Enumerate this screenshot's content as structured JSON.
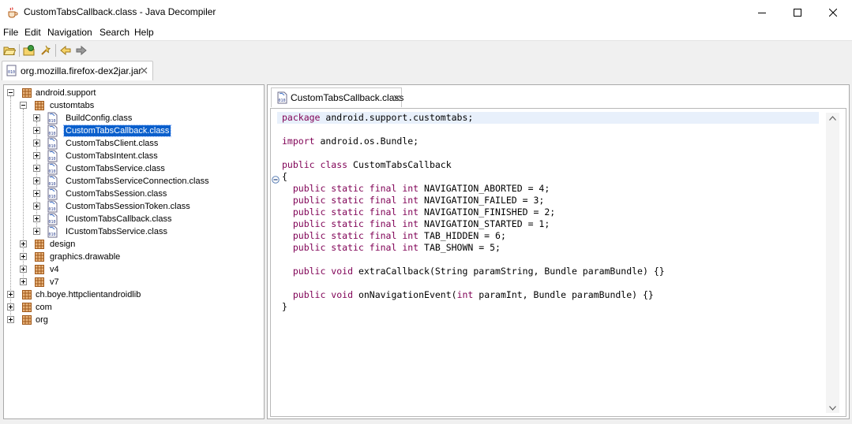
{
  "window": {
    "title": "CustomTabsCallback.class - Java Decompiler",
    "app_icon": "coffee-cup-icon",
    "controls": [
      "minimize-icon",
      "maximize-icon",
      "close-icon"
    ]
  },
  "menu": [
    "File",
    "Edit",
    "Navigation",
    "Search",
    "Help"
  ],
  "toolbar": {
    "buttons": [
      "open-folder-icon",
      "open-type-icon",
      "search-icon",
      "back-arrow-icon",
      "forward-arrow-icon"
    ]
  },
  "outer_tab": {
    "label": "org.mozilla.firefox-dex2jar.jar",
    "icon": "jar-file-icon",
    "close": "close-icon"
  },
  "tree": {
    "nodes": [
      {
        "label": "android.support",
        "kind": "package",
        "expanded": true
      },
      {
        "label": "customtabs",
        "kind": "package",
        "expanded": true
      },
      {
        "label": "BuildConfig.class",
        "kind": "class"
      },
      {
        "label": "CustomTabsCallback.class",
        "kind": "class",
        "selected": true
      },
      {
        "label": "CustomTabsClient.class",
        "kind": "class"
      },
      {
        "label": "CustomTabsIntent.class",
        "kind": "class"
      },
      {
        "label": "CustomTabsService.class",
        "kind": "class"
      },
      {
        "label": "CustomTabsServiceConnection.class",
        "kind": "class"
      },
      {
        "label": "CustomTabsSession.class",
        "kind": "class"
      },
      {
        "label": "CustomTabsSessionToken.class",
        "kind": "class"
      },
      {
        "label": "ICustomTabsCallback.class",
        "kind": "class"
      },
      {
        "label": "ICustomTabsService.class",
        "kind": "class"
      },
      {
        "label": "design",
        "kind": "package"
      },
      {
        "label": "graphics.drawable",
        "kind": "package"
      },
      {
        "label": "v4",
        "kind": "package"
      },
      {
        "label": "v7",
        "kind": "package"
      },
      {
        "label": "ch.boye.httpclientandroidlib",
        "kind": "package"
      },
      {
        "label": "com",
        "kind": "package"
      },
      {
        "label": "org",
        "kind": "package"
      }
    ]
  },
  "source_tab": {
    "label": "CustomTabsCallback.class",
    "icon": "class-file-icon",
    "close": "close-icon"
  },
  "code": {
    "l0_kw": "package",
    "l0": " android.support.customtabs;",
    "l2_kw": "import",
    "l2": " android.os.Bundle;",
    "l4_kw": "public class",
    "l4": " CustomTabsCallback",
    "l5": "{",
    "m": "  public static final int",
    "f1": " NAVIGATION_ABORTED = 4;",
    "f2": " NAVIGATION_FAILED = 3;",
    "f3": " NAVIGATION_FINISHED = 2;",
    "f4": " NAVIGATION_STARTED = 1;",
    "f5": " TAB_HIDDEN = 6;",
    "f6": " TAB_SHOWN = 5;",
    "pv": "  public void",
    "m1": " extraCallback(String paramString, Bundle paramBundle) {}",
    "m2a": " onNavigationEvent(",
    "m2k": "int",
    "m2b": " paramInt, Bundle paramBundle) {}",
    "close": "}"
  },
  "colors": {
    "selection": "#0a5fcc",
    "keyword": "#7f0055",
    "current_line": "#e8f0fb"
  }
}
